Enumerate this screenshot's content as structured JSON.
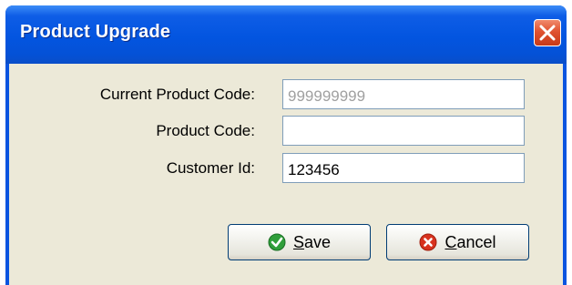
{
  "dialog": {
    "title": "Product Upgrade",
    "close_icon": "close-x-icon"
  },
  "form": {
    "current_product_code": {
      "label": "Current Product Code:",
      "value": "999999999"
    },
    "product_code": {
      "label": "Product Code:",
      "value": ""
    },
    "customer_id": {
      "label": "Customer Id:",
      "value": "123456"
    }
  },
  "buttons": {
    "save": {
      "mnemonic": "S",
      "rest": "ave",
      "icon": "green-check-icon"
    },
    "cancel": {
      "mnemonic": "C",
      "rest": "ancel",
      "icon": "red-x-icon"
    }
  },
  "colors": {
    "titlebar": "#0355e0",
    "client": "#ece9d8",
    "close": "#e05230",
    "save_icon": "#2f9e3a",
    "cancel_icon": "#d8321e"
  }
}
